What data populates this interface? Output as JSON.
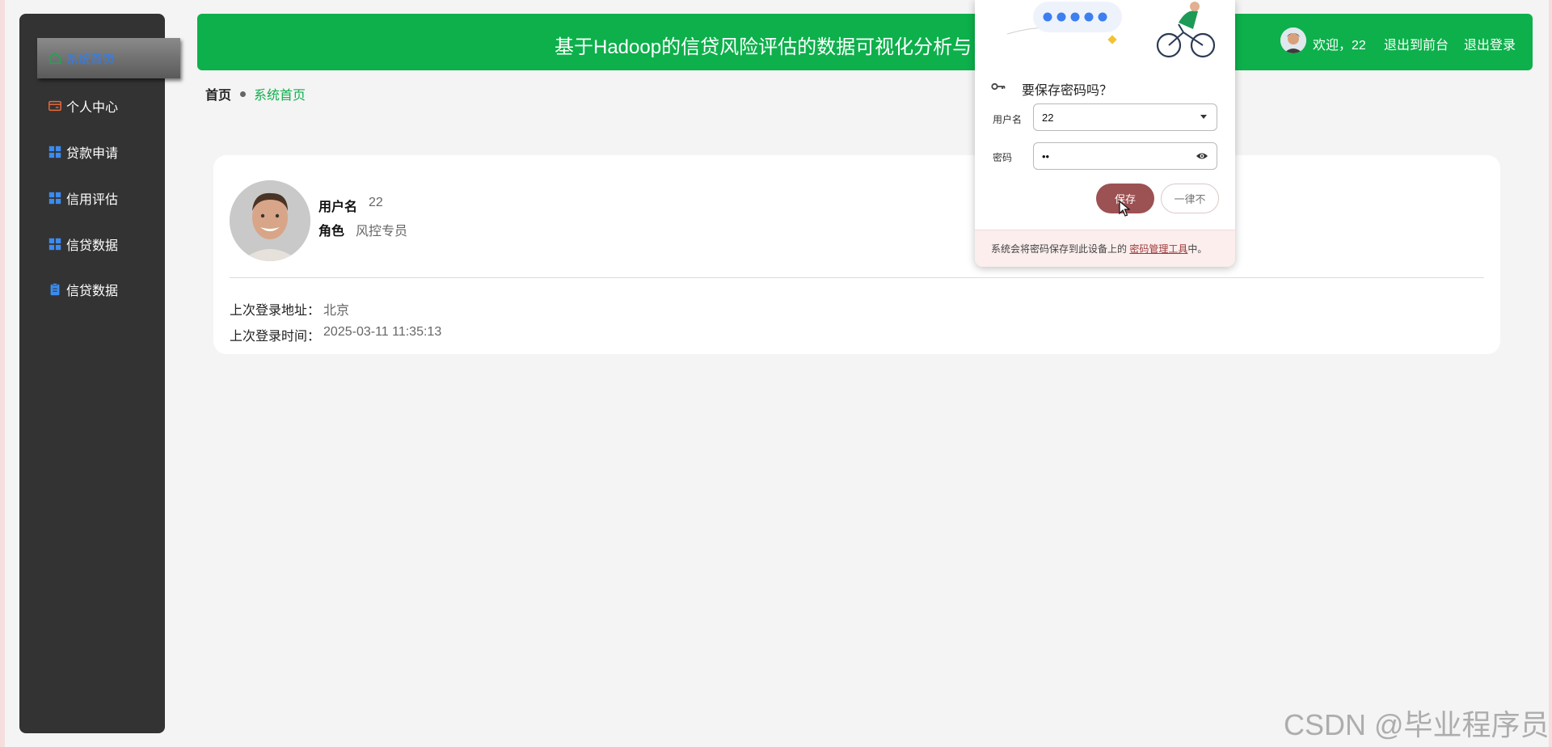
{
  "sidebar": {
    "items": [
      {
        "label": "系统首页",
        "icon": "home-icon"
      },
      {
        "label": "个人中心",
        "icon": "card-icon"
      },
      {
        "label": "贷款申请",
        "icon": "grid-icon"
      },
      {
        "label": "信用评估",
        "icon": "grid-icon"
      },
      {
        "label": "信贷数据",
        "icon": "grid-icon"
      },
      {
        "label": "信贷数据",
        "icon": "clipboard-icon"
      }
    ]
  },
  "header": {
    "title": "基于Hadoop的信贷风险评估的数据可视化分析与",
    "welcome": "欢迎，22",
    "front_link": "退出到前台",
    "logout_link": "退出登录"
  },
  "breadcrumb": {
    "home": "首页",
    "current": "系统首页"
  },
  "profile": {
    "username_label": "用户名",
    "username_value": "22",
    "role_label": "角色",
    "role_value": "风控专员",
    "last_login_addr_label": "上次登录地址：",
    "last_login_addr_value": "北京",
    "last_login_time_label": "上次登录时间：",
    "last_login_time_value": "2025-03-11 11:35:13"
  },
  "password_popup": {
    "heading": "要保存密码吗？",
    "username_label": "用户名",
    "username_value": "22",
    "password_label": "密码",
    "password_value": "••",
    "save_button": "保存",
    "never_button": "一律不",
    "footer_prefix": "系统会将密码保存到此设备上的",
    "footer_link": "密码管理工具",
    "footer_suffix": "中。"
  },
  "watermark": "CSDN @毕业程序员",
  "colors": {
    "header_green": "#0db04b",
    "sidebar_dark": "#333333",
    "save_button": "#9c5153",
    "active_menu_text": "#2f7ef0"
  }
}
